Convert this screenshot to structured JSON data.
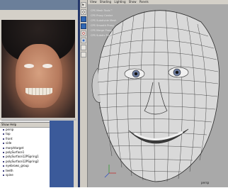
{
  "outliner": {
    "menu": "Show  Help",
    "items": [
      "persp",
      "top",
      "front",
      "side",
      "morphtarget",
      "polySurface1",
      "polySurface12PSpring1",
      "polySurface12PSpring2",
      "eyebrows_group",
      "teeth",
      "spine"
    ]
  },
  "viewport": {
    "menus": [
      "View",
      "Shading",
      "Lighting",
      "Show",
      "Panels"
    ],
    "hud": [
      "CPS Mesh Tools™",
      "CPS Proxy Center",
      "CPS Subdivide Mesh",
      "CPS Smooth Proxy",
      "CPS Merge Proxy",
      "CPS Subdiv Proxy"
    ],
    "camera_label": "persp"
  },
  "colors": {
    "viewport_bg": "#a9a9a9",
    "wire": "#2b2b2b",
    "accent_blue": "#3b5a9a"
  },
  "icons": [
    "select-arrow-icon",
    "lasso-icon",
    "paint-icon",
    "move-icon",
    "rotate-icon",
    "scale-icon",
    "manipulator-icon",
    "last-tool-icon"
  ]
}
